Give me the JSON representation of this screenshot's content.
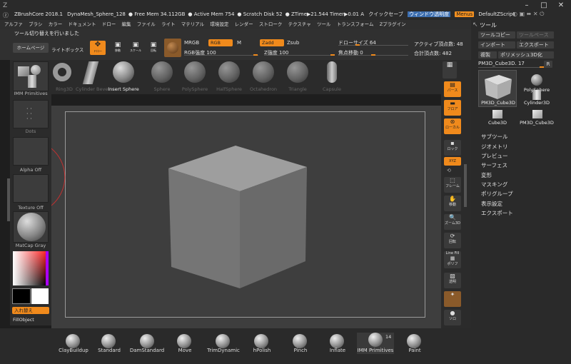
{
  "titlebar": {
    "app": "ZBrushCore 2018.1",
    "project": "DynaMesh_Sphere_128",
    "free_mem": "Free Mem 34.112GB",
    "active_mem": "Active Mem 754",
    "scratch": "Scratch Disk 52",
    "ztime": "ZTime▶21.544 Timer▶0.01 A",
    "quicksave": "クイックセーブ",
    "transparency": "ウィンドウ透明度",
    "menus": "Menus",
    "zscript": "DefaultZScript"
  },
  "menubar": [
    "アルファ",
    "ブラシ",
    "カラー",
    "ドキュメント",
    "ドロー",
    "編集",
    "ファイル",
    "ライト",
    "マテリアル",
    "環境設定",
    "レンダー",
    "ストローク",
    "テクスチャ",
    "ツール",
    "トランスフォーム",
    "Zプラグイン"
  ],
  "notice": "ツール切り替えを行いました",
  "topbar": {
    "home": "ホームページ",
    "lightbox": "ライトボックス",
    "draw": "ドロー",
    "move": "移動",
    "scale": "スケール",
    "rotate": "回転",
    "mrgb": "MRGB",
    "rgb": "RGB",
    "m": "M",
    "rgb_intensity": "RGB強度 100",
    "zadd": "Zadd",
    "zsub": "Zsub",
    "z_intensity": "Z強度 100",
    "draw_size": "ドローサイズ 64",
    "focal_shift": "焦点移動 0",
    "active_points": "アクティブ頂点数: 48",
    "total_points": "合計頂点数: 482"
  },
  "left_tray": {
    "primitives": "IMM Primitives",
    "dots": "Dots",
    "alpha": "Alpha Off",
    "texture": "Texture Off",
    "matcap": "MatCap Gray",
    "swap": "入れ替え",
    "fill": "FillObject",
    "primary_color": "#000000",
    "secondary_color": "#ffffff"
  },
  "shelf": {
    "items": [
      "Ring3D",
      "Cylinder Bevel",
      "Insert Sphere",
      "Sphere",
      "PolySphere",
      "HalfSphere",
      "Octahedron",
      "Triangle",
      "Capsule"
    ]
  },
  "right_tools": [
    "パース",
    "フロア",
    "ローカル",
    "ロック",
    "XYZ",
    "フレーム",
    "移動",
    "ズーム3D",
    "回転",
    "Line Fill",
    "ポリフ",
    "透明",
    "ソロ"
  ],
  "panel": {
    "title": "ツール",
    "load": "ツールコピー",
    "paste": "ツールペースト",
    "import": "インポート",
    "export": "エクスポート",
    "clone": "複製",
    "polymesh": "ポリメッシュ3D化",
    "current": "PM3D_Cube3D. 17",
    "r": "R",
    "thumbs": [
      "PM3D_Cube3D",
      "PolySphere",
      "Cylinder3D",
      "Cube3D",
      "PM3D_Cube3D"
    ],
    "menu": [
      "サブツール",
      "ジオメトリ",
      "プレビュー",
      "サーフェス",
      "変形",
      "マスキング",
      "ポリグループ",
      "表示設定",
      "エクスポート"
    ]
  },
  "brushes": [
    "ClayBuildup",
    "Standard",
    "DamStandard",
    "Move",
    "TrimDynamic",
    "hPolish",
    "Pinch",
    "Inflate",
    "IMM Primitives",
    "Paint"
  ],
  "brush_badge": "14",
  "colors": {
    "accent": "#f08a1c"
  }
}
